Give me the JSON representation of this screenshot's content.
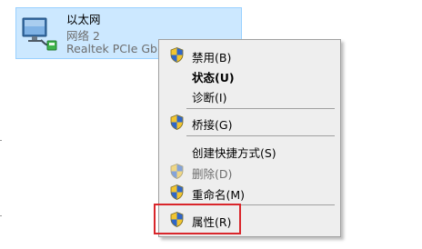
{
  "adapter": {
    "name": "以太网",
    "network": "网络 2",
    "device": "Realtek PCIe GbE"
  },
  "context_menu": {
    "items": [
      {
        "label": "禁用(B)",
        "shield": true,
        "bold": false,
        "disabled": false
      },
      {
        "label": "状态(U)",
        "shield": false,
        "bold": true,
        "disabled": false
      },
      {
        "label": "诊断(I)",
        "shield": false,
        "bold": false,
        "disabled": false
      },
      {
        "label": "桥接(G)",
        "shield": true,
        "bold": false,
        "disabled": false
      },
      {
        "label": "创建快捷方式(S)",
        "shield": false,
        "bold": false,
        "disabled": false
      },
      {
        "label": "删除(D)",
        "shield": true,
        "bold": false,
        "disabled": true
      },
      {
        "label": "重命名(M)",
        "shield": true,
        "bold": false,
        "disabled": false
      },
      {
        "label": "属性(R)",
        "shield": true,
        "bold": false,
        "disabled": false
      }
    ]
  },
  "highlight": {
    "target": "属性(R)",
    "color": "#d9262b"
  },
  "colors": {
    "selection_fill": "#cce8ff",
    "selection_border": "#99d1ff",
    "menu_background": "#eeeeee",
    "disabled_text": "#6d6d6d"
  },
  "icons": {
    "adapter": "ethernet-adapter-icon",
    "uac": "uac-shield-icon"
  }
}
